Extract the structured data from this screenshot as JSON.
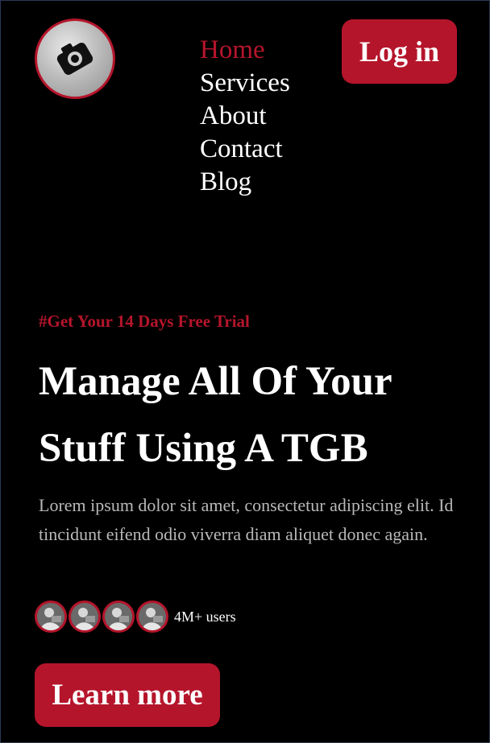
{
  "brand": {
    "logo_icon": "camera-tag-icon",
    "accent_color": "#b5152b"
  },
  "nav": {
    "items": [
      {
        "label": "Home",
        "active": true
      },
      {
        "label": "Services",
        "active": false
      },
      {
        "label": "About",
        "active": false
      },
      {
        "label": "Contact",
        "active": false
      },
      {
        "label": "Blog",
        "active": false
      }
    ]
  },
  "header": {
    "login_label": "Log in"
  },
  "hero": {
    "promo": "#Get Your 14 Days Free Trial",
    "headline_line1": "Manage All Of Your",
    "headline_line2": "Stuff Using A TGB",
    "description": "Lorem ipsum dolor sit amet, consectetur adipiscing elit. Id tincidunt eifend odio viverra diam aliquet donec again.",
    "users_count": "4M+ users",
    "cta_label": "Learn more"
  }
}
